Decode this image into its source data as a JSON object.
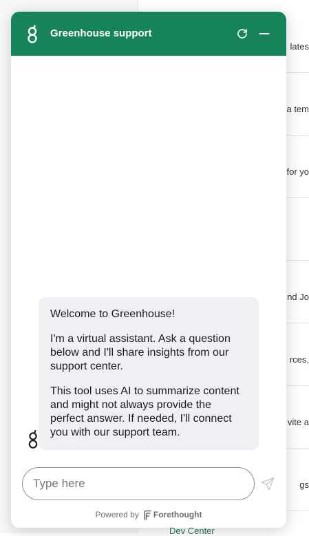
{
  "background_page": {
    "rows": [
      {
        "text": "lates"
      },
      {
        "text": "ia tem"
      },
      {
        "text": "for yo"
      },
      {
        "text": ""
      },
      {
        "text": "nd Jo"
      },
      {
        "text": "rces,"
      },
      {
        "text": "vite a"
      },
      {
        "text": "gs"
      }
    ],
    "dev_center_link": "Dev Center"
  },
  "chat": {
    "header": {
      "title": "Greenhouse support",
      "logo_icon": "greenhouse-g-icon",
      "refresh_icon": "refresh-icon",
      "minimize_icon": "minimize-icon",
      "background_color": "#168458"
    },
    "messages": [
      {
        "sender": "bot",
        "avatar_icon": "greenhouse-g-icon",
        "paragraphs": [
          "Welcome to Greenhouse!",
          "I'm a virtual assistant. Ask a question below and I'll share insights from our support center.",
          "This tool uses AI to summarize content and might not always provide the perfect answer. If needed, I'll connect you with our support team."
        ]
      }
    ],
    "input": {
      "placeholder": "Type here",
      "value": ""
    },
    "send_icon": "send-icon",
    "footer": {
      "powered_by": "Powered by",
      "brand": "Forethought",
      "brand_icon": "forethought-icon"
    }
  }
}
